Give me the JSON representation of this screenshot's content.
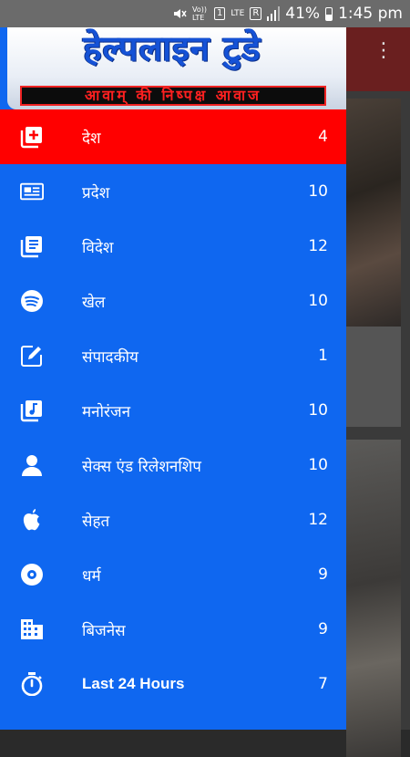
{
  "status_bar": {
    "network_label": "Vo)) LTE",
    "sim_badge": "1",
    "lte_label": "LTE",
    "r_badge": "R",
    "battery": "41%",
    "time": "1:45 pm"
  },
  "header": {
    "title": "हेल्पलाइन टुडे",
    "tagline": "आवाम् की निष्पक्ष आवाज"
  },
  "menu": [
    {
      "label": "देश",
      "count": "4",
      "icon": "add-box-icon",
      "active": true
    },
    {
      "label": "प्रदेश",
      "count": "10",
      "icon": "newspaper-icon"
    },
    {
      "label": "विदेश",
      "count": "12",
      "icon": "article-icon"
    },
    {
      "label": "खेल",
      "count": "10",
      "icon": "spotify-icon"
    },
    {
      "label": "संपादकीय",
      "count": "1",
      "icon": "edit-icon"
    },
    {
      "label": "मनोरंजन",
      "count": "10",
      "icon": "music-library-icon"
    },
    {
      "label": "सेक्स एंड रिलेशनशिप",
      "count": "10",
      "icon": "person-icon"
    },
    {
      "label": "सेहत",
      "count": "12",
      "icon": "apple-icon"
    },
    {
      "label": "धर्म",
      "count": "9",
      "icon": "disc-icon"
    },
    {
      "label": "बिजनेस",
      "count": "9",
      "icon": "building-icon"
    },
    {
      "label": "Last 24 Hours",
      "count": "7",
      "icon": "stopwatch-icon"
    }
  ],
  "colors": {
    "drawer_bg": "#0f67f0",
    "active_item": "#ff0000",
    "header_title": "#1552d6",
    "tagline_text": "#ff2020"
  }
}
